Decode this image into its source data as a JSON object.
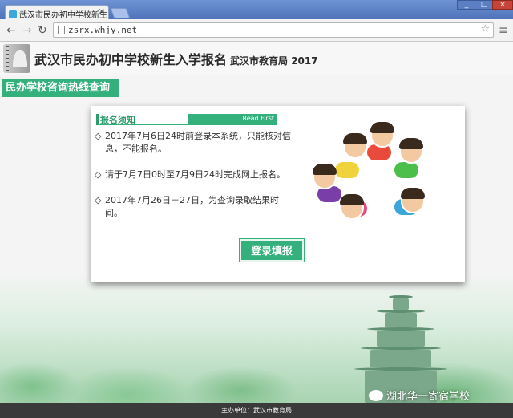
{
  "browser": {
    "tab_title": "武汉市民办初中学校新生",
    "tab_close": "×",
    "url": "zsrx.whjy.net",
    "back_icon": "←",
    "forward_icon": "→",
    "reload_icon": "↻",
    "star_icon": "☆",
    "menu_icon": "≡",
    "window_minimize": "_",
    "window_maximize": "□",
    "window_close": "×"
  },
  "header": {
    "title": "武汉市民办初中学校新生入学报名",
    "org_year": "武汉市教育局 2017"
  },
  "nav": {
    "hotline_query": "民办学校咨询热线查询"
  },
  "notice": {
    "heading": "报名须知",
    "read_first": "Read First",
    "bullet": "◇",
    "items": [
      "2017年7月6日24时前登录本系统，只能核对信息，不能报名。",
      "请于7月7日0时至7月9日24时完成网上报名。",
      "2017年7月26日－27日，为查询录取结果时间。"
    ]
  },
  "actions": {
    "login_label": "登录填报"
  },
  "footer": {
    "sponsor": "主办单位：武汉市教育局"
  },
  "watermark": {
    "text": "湖北华一寄宿学校"
  },
  "colors": {
    "accent_green": "#33b07c",
    "footer_bg": "#3a3a3a",
    "chrome_blue": "#4e73b9"
  }
}
